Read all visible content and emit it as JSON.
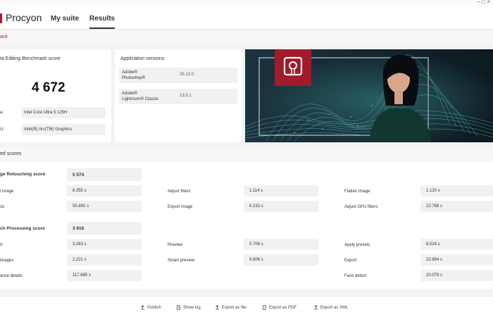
{
  "titlebar": {
    "controls": "– □ ×"
  },
  "nav": {
    "brand": "Procyon",
    "tabs": [
      "My suite",
      "Results"
    ],
    "active": "Results"
  },
  "subnav": {
    "back_label": "ack"
  },
  "summary": {
    "title": "ta Editing Benchmark score",
    "score": "4 672",
    "specs": [
      {
        "label": "a:",
        "value": "Intel Core Ultra 5 125H"
      },
      {
        "label": "U:",
        "value": "Intel(R) Arc(TM) Graphics"
      }
    ]
  },
  "app_versions": {
    "title": "Application versions",
    "apps": [
      {
        "name_line1": "Adobe®",
        "name_line2": "Photoshop®",
        "version": "25.12.0"
      },
      {
        "name_line1": "Adobe®",
        "name_line2": "Lightroom® Classic",
        "version": "13.5.1"
      }
    ]
  },
  "detailed": {
    "title": "ed scores"
  },
  "retouch": {
    "label": "ge Retouching score",
    "score": "5 574",
    "rows": [
      [
        {
          "label": "l image",
          "value": "8.355 s"
        },
        {
          "label": "Adjust filters",
          "value": "1.114 s"
        },
        {
          "label": "Flatten image",
          "value": "1.120 s"
        }
      ],
      [
        {
          "label": "ze",
          "value": "55.892 s"
        },
        {
          "label": "Export image",
          "value": "6.232 s"
        },
        {
          "label": "Adjust GPU filters",
          "value": "22.768 s"
        }
      ]
    ]
  },
  "batch": {
    "label": "ch Processing score",
    "score": "3 916",
    "rows": [
      [
        {
          "label": "rt",
          "value": "3.263 s"
        },
        {
          "label": "Preview",
          "value": "0.708 s"
        },
        {
          "label": "Apply presets",
          "value": "8.524 s"
        }
      ],
      [
        {
          "label": "images",
          "value": "2.221 s"
        },
        {
          "label": "Smart preview",
          "value": "9.808 s"
        },
        {
          "label": "Export",
          "value": "22.894 s"
        }
      ],
      [
        {
          "label": "ance details",
          "value": "117.885 s"
        },
        {
          "label": "",
          "value": ""
        },
        {
          "label": "Face detect",
          "value": "20.079 s"
        }
      ]
    ]
  },
  "footer": {
    "buttons": [
      {
        "label": "Publish",
        "icon": "upload-icon"
      },
      {
        "label": "Show log",
        "icon": "document-icon"
      },
      {
        "label": "Export as file",
        "icon": "export-icon"
      },
      {
        "label": "Export as PDF",
        "icon": "pdf-icon"
      },
      {
        "label": "Export as XML",
        "icon": "export-icon"
      }
    ]
  },
  "colors": {
    "accent": "#c8102e",
    "hero_bg": "#152a34",
    "hero_wave": "#5fc9c4"
  }
}
